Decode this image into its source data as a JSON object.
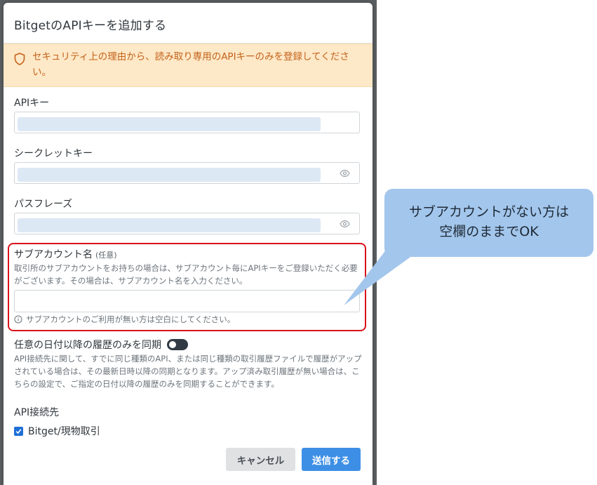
{
  "modal": {
    "title": "BitgetのAPIキーを追加する"
  },
  "alert": {
    "icon": "shield-icon",
    "text": "セキュリティ上の理由から、読み取り専用のAPIキーのみを登録してください。"
  },
  "fields": {
    "api_key_label": "APIキー",
    "secret_key_label": "シークレットキー",
    "passphrase_label": "パスフレーズ"
  },
  "subaccount": {
    "label": "サブアカウント名",
    "optional": "(任意)",
    "help": "取引所のサブアカウントをお持ちの場合は、サブアカウント毎にAPIキーをご登録いただく必要がございます。その場合は、サブアカウント名を入力ください。",
    "value": "",
    "note": "サブアカウントのご利用が無い方は空白にしてください。"
  },
  "sync": {
    "label": "任意の日付以降の履歴のみを同期",
    "toggle_on": false,
    "help": "API接続先に関して、すでに同じ種類のAPI、または同じ種類の取引履歴ファイルで履歴がアップされている場合は、その最新日時以降の同期となります。アップ済み取引履歴が無い場合は、こちらの設定で、ご指定の日付以降の履歴のみを同期することができます。"
  },
  "api_target": {
    "label": "API接続先",
    "option_label": "Bitget/現物取引",
    "checked": true
  },
  "buttons": {
    "cancel": "キャンセル",
    "submit": "送信する"
  },
  "callout": {
    "line1": "サブアカウントがない方は",
    "line2": "空欄のままでOK"
  },
  "colors": {
    "accent": "#3d8fe6",
    "alert_bg": "#fde8c7",
    "alert_text": "#c4621a",
    "highlight_border": "#d9121b",
    "callout_bg": "#a3c6ec"
  }
}
